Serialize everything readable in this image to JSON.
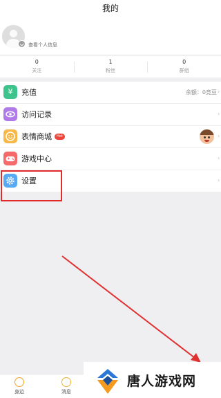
{
  "header": {
    "title": "我的"
  },
  "profile": {
    "view_info": "查看个人信息"
  },
  "stats": [
    {
      "value": "0",
      "label": "关注"
    },
    {
      "value": "1",
      "label": "粉丝"
    },
    {
      "value": "0",
      "label": "群组"
    }
  ],
  "menu": {
    "recharge": {
      "label": "充值",
      "balance": "余额：0竞豆",
      "icon": "yen-icon",
      "color": "#3dc48c"
    },
    "visits": {
      "label": "访问记录",
      "icon": "eye-icon",
      "color": "#b07be8"
    },
    "emoji_store": {
      "label": "表情商城",
      "badge": "Hot",
      "icon": "smile-icon",
      "color": "#f7b84a"
    },
    "game_center": {
      "label": "游戏中心",
      "icon": "gamepad-icon",
      "color": "#f56a6a"
    },
    "settings": {
      "label": "设置",
      "icon": "gear-icon",
      "color": "#5aa9f5"
    }
  },
  "tabbar": {
    "tabs": [
      {
        "label": "身边"
      },
      {
        "label": "消息"
      }
    ]
  },
  "watermark": {
    "text": "唐人游戏网"
  },
  "colors": {
    "highlight": "#e12b2b",
    "arrow": "#e03030"
  }
}
